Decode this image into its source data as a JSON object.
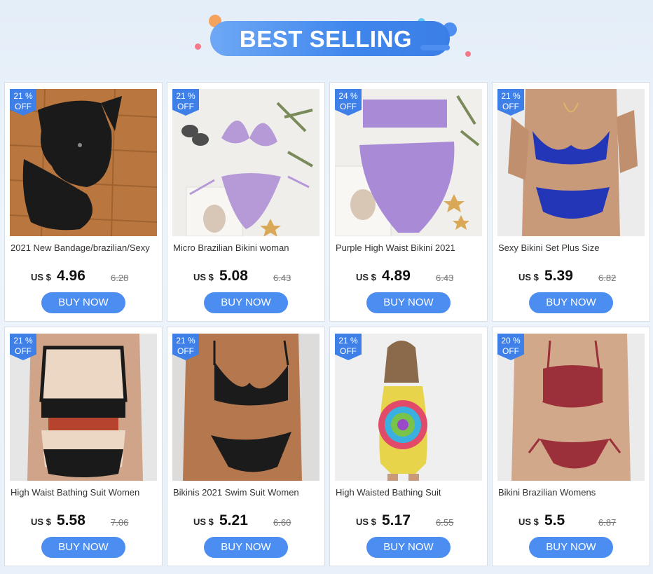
{
  "banner": {
    "title": "BEST SELLING"
  },
  "badge_suffix": "OFF",
  "currency": "US $",
  "buy_label": "BUY NOW",
  "products": [
    {
      "name": "2021 New Bandage/brazilian/Sexy",
      "discount": "21 %",
      "price": "4.96",
      "old_price": "6.28",
      "image": "black-bikini-on-wood"
    },
    {
      "name": "Micro Brazilian Bikini woman",
      "discount": "21 %",
      "price": "5.08",
      "old_price": "6.43",
      "image": "lilac-string-bikini"
    },
    {
      "name": "Purple High Waist Bikini 2021",
      "discount": "24 %",
      "price": "4.89",
      "old_price": "6.43",
      "image": "purple-high-waist-bikini"
    },
    {
      "name": "Sexy Bikini Set Plus Size",
      "discount": "21 %",
      "price": "5.39",
      "old_price": "6.82",
      "image": "blue-bikini-model"
    },
    {
      "name": "High Waist Bathing Suit Women",
      "discount": "21 %",
      "price": "5.58",
      "old_price": "7.06",
      "image": "colorblock-bathing-suit-model"
    },
    {
      "name": "Bikinis 2021 Swim Suit Women",
      "discount": "21 %",
      "price": "5.21",
      "old_price": "6.60",
      "image": "black-bikini-model"
    },
    {
      "name": "High Waisted Bathing Suit",
      "discount": "21 %",
      "price": "5.17",
      "old_price": "6.55",
      "image": "tie-dye-swimsuit-model"
    },
    {
      "name": "Bikini Brazilian Womens",
      "discount": "20 %",
      "price": "5.5",
      "old_price": "6.87",
      "image": "red-ruffle-bikini-model"
    }
  ],
  "colors": {
    "accent": "#4b8df0",
    "badge": "#3e7fe8"
  }
}
